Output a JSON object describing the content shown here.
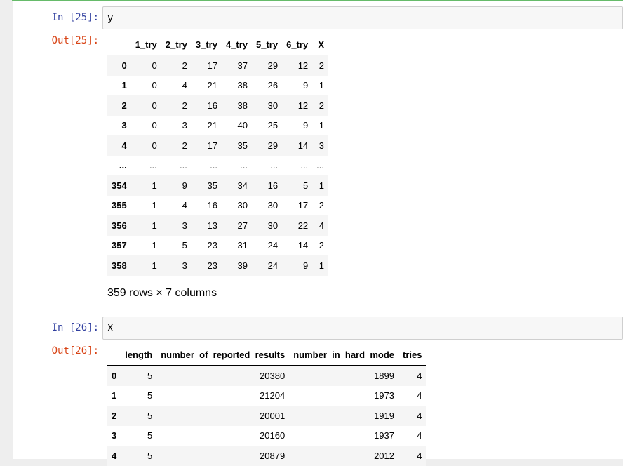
{
  "cell25": {
    "in_prompt": "In  [25]:",
    "code": "y",
    "out_prompt": "Out[25]:",
    "table": {
      "columns": [
        "1_try",
        "2_try",
        "3_try",
        "4_try",
        "5_try",
        "6_try",
        "X"
      ],
      "rows": [
        {
          "index": "0",
          "values": [
            "0",
            "2",
            "17",
            "37",
            "29",
            "12",
            "2"
          ]
        },
        {
          "index": "1",
          "values": [
            "0",
            "4",
            "21",
            "38",
            "26",
            "9",
            "1"
          ]
        },
        {
          "index": "2",
          "values": [
            "0",
            "2",
            "16",
            "38",
            "30",
            "12",
            "2"
          ]
        },
        {
          "index": "3",
          "values": [
            "0",
            "3",
            "21",
            "40",
            "25",
            "9",
            "1"
          ]
        },
        {
          "index": "4",
          "values": [
            "0",
            "2",
            "17",
            "35",
            "29",
            "14",
            "3"
          ]
        },
        {
          "index": "...",
          "values": [
            "...",
            "...",
            "...",
            "...",
            "...",
            "...",
            "..."
          ]
        },
        {
          "index": "354",
          "values": [
            "1",
            "9",
            "35",
            "34",
            "16",
            "5",
            "1"
          ]
        },
        {
          "index": "355",
          "values": [
            "1",
            "4",
            "16",
            "30",
            "30",
            "17",
            "2"
          ]
        },
        {
          "index": "356",
          "values": [
            "1",
            "3",
            "13",
            "27",
            "30",
            "22",
            "4"
          ]
        },
        {
          "index": "357",
          "values": [
            "1",
            "5",
            "23",
            "31",
            "24",
            "14",
            "2"
          ]
        },
        {
          "index": "358",
          "values": [
            "1",
            "3",
            "23",
            "39",
            "24",
            "9",
            "1"
          ]
        }
      ]
    },
    "shape": "359 rows × 7 columns"
  },
  "cell26": {
    "in_prompt": "In  [26]:",
    "code": "X",
    "out_prompt": "Out[26]:",
    "table": {
      "columns": [
        "length",
        "number_of_reported_results",
        "number_in_hard_mode",
        "tries"
      ],
      "rows": [
        {
          "index": "0",
          "values": [
            "5",
            "20380",
            "1899",
            "4"
          ]
        },
        {
          "index": "1",
          "values": [
            "5",
            "21204",
            "1973",
            "4"
          ]
        },
        {
          "index": "2",
          "values": [
            "5",
            "20001",
            "1919",
            "4"
          ]
        },
        {
          "index": "3",
          "values": [
            "5",
            "20160",
            "1937",
            "4"
          ]
        },
        {
          "index": "4",
          "values": [
            "5",
            "20879",
            "2012",
            "4"
          ]
        }
      ]
    }
  }
}
